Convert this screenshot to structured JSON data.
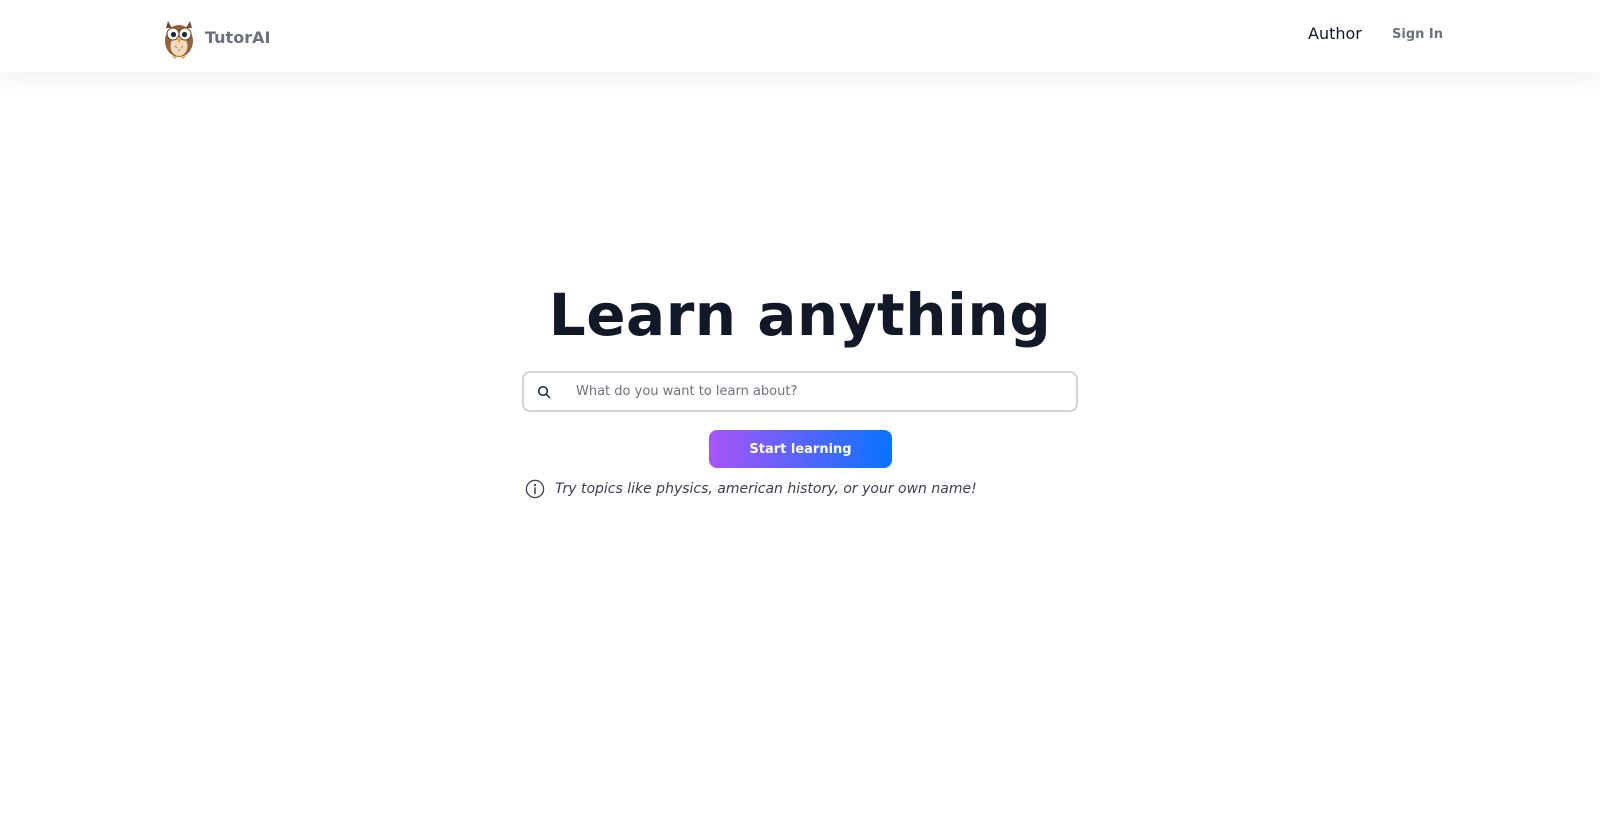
{
  "header": {
    "brand_name": "TutorAI",
    "brand_icon": "owl-logo-icon",
    "nav": {
      "author_label": "Author",
      "signin_label": "Sign In"
    }
  },
  "hero": {
    "title": "Learn anything",
    "search": {
      "placeholder": "What do you want to learn about?",
      "value": "",
      "icon": "search-icon"
    },
    "start_button_label": "Start learning",
    "hint": {
      "icon": "info-icon",
      "text": "Try topics like physics, american history, or your own name!"
    }
  },
  "colors": {
    "title": "#111827",
    "muted": "#6b7280",
    "button_gradient_start": "#a855f7",
    "button_gradient_end": "#0873ff",
    "input_border": "#d1d5db"
  }
}
